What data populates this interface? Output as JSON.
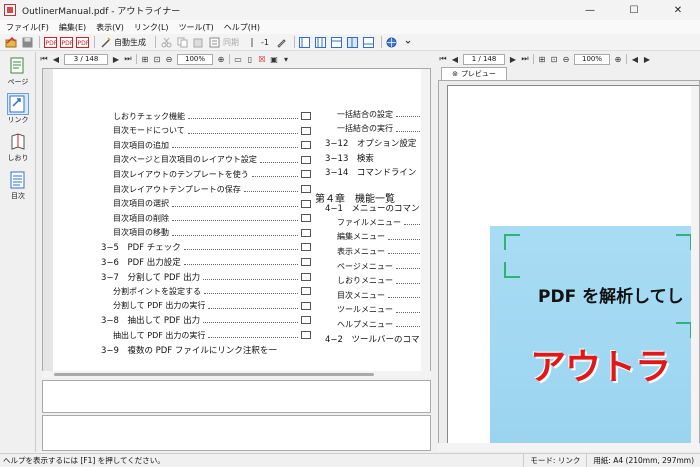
{
  "window": {
    "title": "OutlinerManual.pdf - アウトライナー",
    "minimize": "—",
    "maximize": "☐",
    "close": "✕"
  },
  "menu": [
    {
      "label": "ファイル(F)"
    },
    {
      "label": "編集(E)"
    },
    {
      "label": "表示(V)"
    },
    {
      "label": "リンク(L)"
    },
    {
      "label": "ツール(T)"
    },
    {
      "label": "ヘルプ(H)"
    }
  ],
  "toolbar": {
    "auto_generate": "自動生成",
    "sync": "同期",
    "level": "-1"
  },
  "sidepane": {
    "page": "ページ",
    "link": "リンク",
    "bookmark": "しおり",
    "toc": "目次"
  },
  "left_nav": {
    "page": "3 / 148",
    "zoom": "100%"
  },
  "right_nav": {
    "page": "1 / 148",
    "zoom": "100%"
  },
  "preview_tab": "プレビュー",
  "toc_left": [
    {
      "text": "しおりチェック機能",
      "indent": 2,
      "kind": "item"
    },
    {
      "text": "目次モードについて",
      "indent": 2,
      "kind": "item"
    },
    {
      "text": "目次項目の追加",
      "indent": 2,
      "kind": "item"
    },
    {
      "text": "目次ページと目次項目のレイアウト設定",
      "indent": 2,
      "kind": "item"
    },
    {
      "text": "目次レイアウトのテンプレートを使う",
      "indent": 2,
      "kind": "item"
    },
    {
      "text": "目次レイアウトテンプレートの保存",
      "indent": 2,
      "kind": "item"
    },
    {
      "text": "目次項目の選択",
      "indent": 2,
      "kind": "item"
    },
    {
      "text": "目次項目の削除",
      "indent": 2,
      "kind": "item"
    },
    {
      "text": "目次項目の移動",
      "indent": 2,
      "kind": "item"
    },
    {
      "text": "3−5　PDF チェック",
      "indent": 1,
      "kind": "sec"
    },
    {
      "text": "3−6　PDF 出力設定",
      "indent": 1,
      "kind": "sec"
    },
    {
      "text": "3−7　分割して PDF 出力",
      "indent": 1,
      "kind": "sec"
    },
    {
      "text": "分割ポイントを設定する",
      "indent": 2,
      "kind": "item"
    },
    {
      "text": "分割して PDF 出力の実行",
      "indent": 2,
      "kind": "item"
    },
    {
      "text": "3−8　抽出して PDF 出力",
      "indent": 1,
      "kind": "sec"
    },
    {
      "text": "抽出して PDF 出力の実行",
      "indent": 2,
      "kind": "item"
    },
    {
      "text": "3−9　複数の PDF ファイルにリンク注釈を一",
      "indent": 1,
      "kind": "sec"
    }
  ],
  "toc_right": [
    {
      "text": "一括結合の設定",
      "indent": 2,
      "kind": "item"
    },
    {
      "text": "一括結合の実行",
      "indent": 2,
      "kind": "item"
    },
    {
      "text": "3−12　オプション設定",
      "indent": 1,
      "kind": "sec"
    },
    {
      "text": "3−13　検索",
      "indent": 1,
      "kind": "sec"
    },
    {
      "text": "3−14　コマンドライン",
      "indent": 1,
      "kind": "sec"
    },
    {
      "text": "第４章　機能一覧",
      "indent": 0,
      "kind": "chap"
    },
    {
      "text": "4−1　メニューのコマン",
      "indent": 1,
      "kind": "sec"
    },
    {
      "text": "ファイルメニュー",
      "indent": 2,
      "kind": "item"
    },
    {
      "text": "編集メニュー",
      "indent": 2,
      "kind": "item"
    },
    {
      "text": "表示メニュー",
      "indent": 2,
      "kind": "item"
    },
    {
      "text": "ページメニュー",
      "indent": 2,
      "kind": "item"
    },
    {
      "text": "しおりメニュー",
      "indent": 2,
      "kind": "item"
    },
    {
      "text": "目次メニュー",
      "indent": 2,
      "kind": "item"
    },
    {
      "text": "ツールメニュー",
      "indent": 2,
      "kind": "item"
    },
    {
      "text": "ヘルプメニュー",
      "indent": 2,
      "kind": "item"
    },
    {
      "text": "4−2　ツールバーのコマ",
      "indent": 1,
      "kind": "sec"
    }
  ],
  "preview": {
    "headline": "PDF を解析してし",
    "logo": "アウトラ"
  },
  "status": {
    "hint": "ヘルプを表示するには [F1] を押してください。",
    "mode": "モード: リンク",
    "paper": "用紙: A4 (210mm, 297mm)"
  },
  "colors": {
    "accent": "#2f6fd0",
    "preview_bg": "#a9dcf4",
    "logo_red": "#e01818",
    "frame_green": "#2fb27a"
  }
}
